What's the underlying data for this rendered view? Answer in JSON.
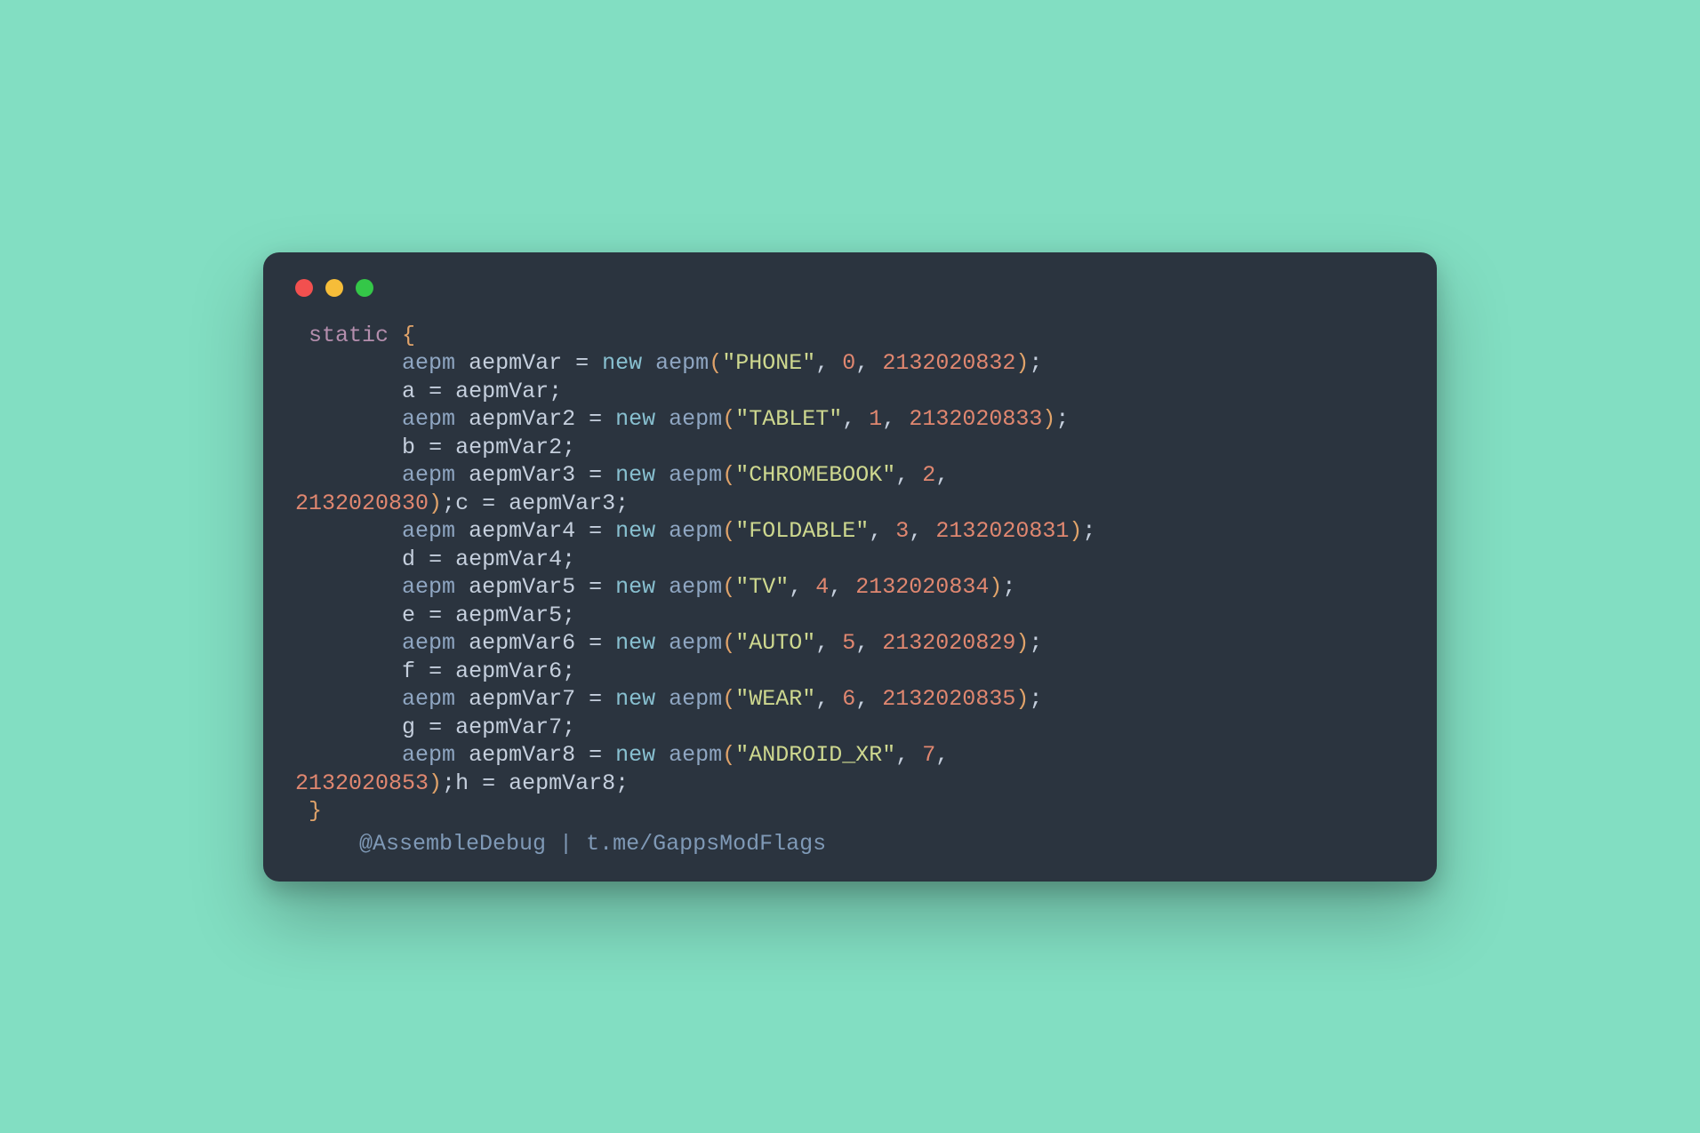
{
  "colors": {
    "background": "#82dec2",
    "panel": "#2b343f",
    "keyword": "#b48ead",
    "class": "#8fa6c2",
    "variable": "#c5cfdd",
    "new": "#88c0d0",
    "string": "#ced88f",
    "number": "#e08770",
    "paren": "#e0a36a",
    "footer": "#7f99b6",
    "traffic_red": "#f2504f",
    "traffic_yellow": "#f6bd39",
    "traffic_green": "#34c748"
  },
  "code": {
    "keyword_static": "static",
    "class_name": "aepm",
    "new_kw": "new",
    "open_brace": "{",
    "close_brace": "}",
    "semi": ";",
    "eq": "=",
    "comma": ",",
    "lparen": "(",
    "rparen": ")",
    "quote": "\"",
    "entries": [
      {
        "var": "aepmVar",
        "assign": "a",
        "str": "PHONE",
        "idx": "0",
        "id": "2132020832",
        "wrap": false
      },
      {
        "var": "aepmVar2",
        "assign": "b",
        "str": "TABLET",
        "idx": "1",
        "id": "2132020833",
        "wrap": false
      },
      {
        "var": "aepmVar3",
        "assign": "c",
        "str": "CHROMEBOOK",
        "idx": "2",
        "id": "2132020830",
        "wrap": true
      },
      {
        "var": "aepmVar4",
        "assign": "d",
        "str": "FOLDABLE",
        "idx": "3",
        "id": "2132020831",
        "wrap": false
      },
      {
        "var": "aepmVar5",
        "assign": "e",
        "str": "TV",
        "idx": "4",
        "id": "2132020834",
        "wrap": false
      },
      {
        "var": "aepmVar6",
        "assign": "f",
        "str": "AUTO",
        "idx": "5",
        "id": "2132020829",
        "wrap": false
      },
      {
        "var": "aepmVar7",
        "assign": "g",
        "str": "WEAR",
        "idx": "6",
        "id": "2132020835",
        "wrap": false
      },
      {
        "var": "aepmVar8",
        "assign": "h",
        "str": "ANDROID_XR",
        "idx": "7",
        "id": "2132020853",
        "wrap": true
      }
    ]
  },
  "footer": {
    "handle": "@AssembleDebug",
    "sep": " | ",
    "link": "t.me/GappsModFlags"
  }
}
